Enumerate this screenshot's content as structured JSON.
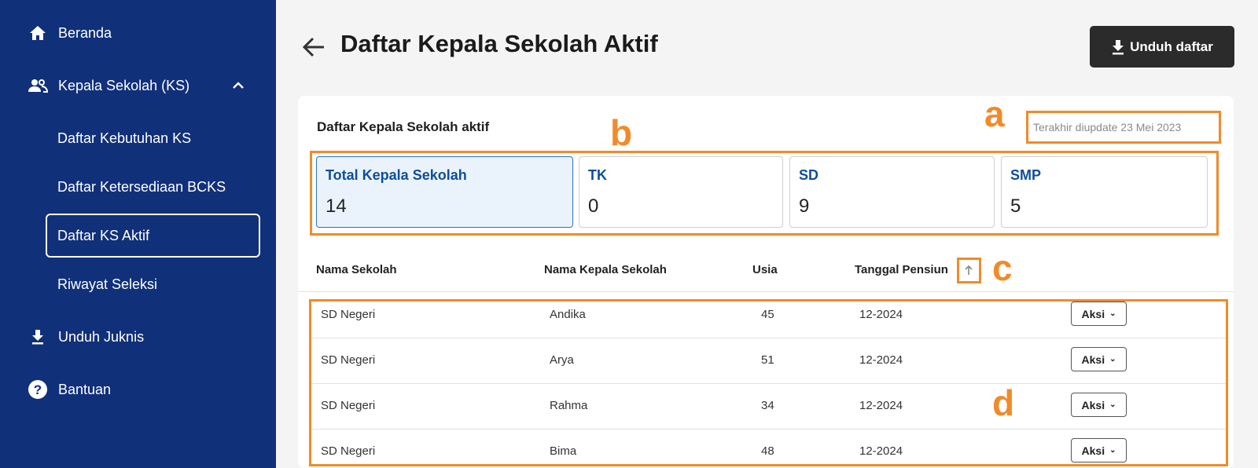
{
  "sidebar": {
    "items": [
      {
        "label": "Beranda",
        "icon": "home-icon"
      },
      {
        "label": "Kepala Sekolah (KS)",
        "icon": "users-icon"
      },
      {
        "label": "Unduh Juknis",
        "icon": "download-icon"
      },
      {
        "label": "Bantuan",
        "icon": "help-icon"
      }
    ],
    "subitems": [
      {
        "label": "Daftar Kebutuhan KS"
      },
      {
        "label": "Daftar Ketersediaan BCKS"
      },
      {
        "label": "Daftar KS Aktif"
      },
      {
        "label": "Riwayat Seleksi"
      }
    ]
  },
  "header": {
    "title": "Daftar Kepala Sekolah Aktif",
    "download_label": "Unduh daftar"
  },
  "card": {
    "title": "Daftar Kepala Sekolah aktif",
    "updated": "Terakhir diupdate 23 Mei 2023"
  },
  "stats": [
    {
      "label": "Total Kepala Sekolah",
      "value": "14"
    },
    {
      "label": "TK",
      "value": "0"
    },
    {
      "label": "SD",
      "value": "9"
    },
    {
      "label": "SMP",
      "value": "5"
    }
  ],
  "table": {
    "columns": [
      "Nama Sekolah",
      "Nama Kepala Sekolah",
      "Usia",
      "Tanggal Pensiun"
    ],
    "action_label": "Aksi",
    "rows": [
      {
        "sekolah": "SD Negeri",
        "kepala": "Andika",
        "usia": "45",
        "pensiun": "12-2024"
      },
      {
        "sekolah": "SD Negeri",
        "kepala": "Arya",
        "usia": "51",
        "pensiun": "12-2024"
      },
      {
        "sekolah": "SD Negeri",
        "kepala": "Rahma",
        "usia": "34",
        "pensiun": "12-2024"
      },
      {
        "sekolah": "SD Negeri",
        "kepala": "Bima",
        "usia": "48",
        "pensiun": "12-2024"
      }
    ]
  },
  "annotations": {
    "a": "a",
    "b": "b",
    "c": "c",
    "d": "d"
  },
  "colors": {
    "sidebar_bg": "#11307a",
    "accent_blue": "#0e4e9a",
    "annotation_orange": "#f08b2a",
    "button_dark": "#2b2b2b"
  }
}
